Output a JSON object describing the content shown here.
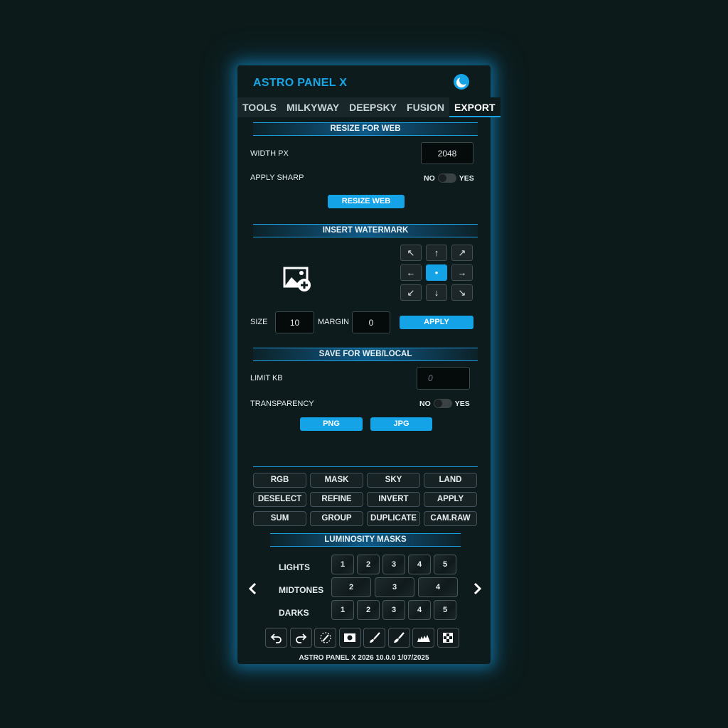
{
  "app": {
    "title": "ASTRO PANEL X"
  },
  "tabs": [
    {
      "label": "TOOLS"
    },
    {
      "label": "MILKYWAY"
    },
    {
      "label": "DEEPSKY"
    },
    {
      "label": "FUSION"
    },
    {
      "label": "EXPORT",
      "active": true
    }
  ],
  "resize": {
    "heading": "RESIZE FOR WEB",
    "width_label": "WIDTH PX",
    "width_value": "2048",
    "sharp_label": "APPLY SHARP",
    "no": "NO",
    "yes": "YES",
    "button": "RESIZE WEB"
  },
  "watermark": {
    "heading": "INSERT WATERMARK",
    "arrows": [
      "↖",
      "↑",
      "↗",
      "←",
      "•",
      "→",
      "↙",
      "↓",
      "↘"
    ],
    "size_label": "SIZE",
    "size_value": "10",
    "margin_label": "MARGIN",
    "margin_value": "0",
    "apply": "APPLY"
  },
  "save": {
    "heading": "SAVE FOR WEB/LOCAL",
    "limit_label": "LIMIT KB",
    "limit_placeholder": "0",
    "transparency_label": "TRANSPARENCY",
    "no": "NO",
    "yes": "YES",
    "png": "PNG",
    "jpg": "JPG"
  },
  "grid_buttons": [
    "RGB",
    "MASK",
    "SKY",
    "LAND",
    "DESELECT",
    "REFINE",
    "INVERT",
    "APPLY",
    "SUM",
    "GROUP",
    "DUPLICATE",
    "CAM.RAW"
  ],
  "luminosity": {
    "heading": "LUMINOSITY MASKS",
    "lights_label": "LIGHTS",
    "lights": [
      "1",
      "2",
      "3",
      "4",
      "5"
    ],
    "midtones_label": "MIDTONES",
    "midtones": [
      "2",
      "3",
      "4"
    ],
    "darks_label": "DARKS",
    "darks": [
      "1",
      "2",
      "3",
      "4",
      "5"
    ]
  },
  "toolbar_icons": [
    "undo-icon",
    "redo-icon",
    "magic-brush-icon",
    "layer-mask-icon",
    "brush-icon",
    "paint-brush-icon",
    "histogram-icon",
    "checker-icon"
  ],
  "footer": "ASTRO PANEL X 2026 10.0.0 1/07/2025",
  "colors": {
    "accent": "#15a3e8",
    "background": "#0d1b1c",
    "page": "#0c1a1a"
  }
}
